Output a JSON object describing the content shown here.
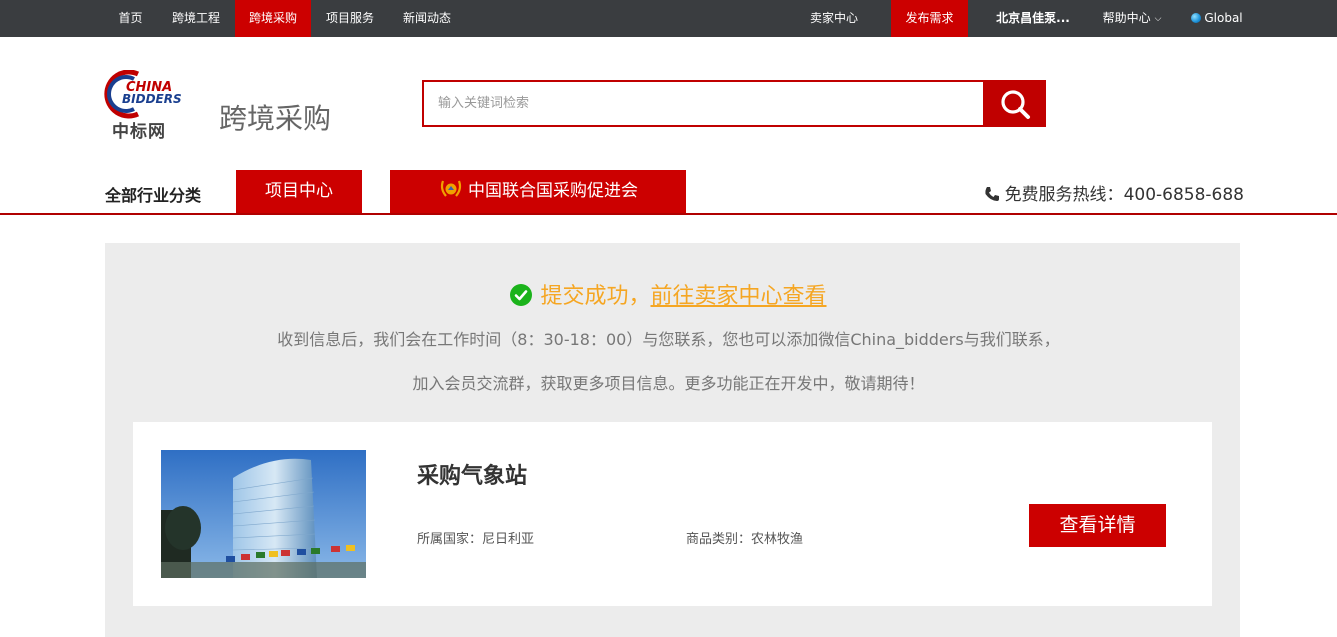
{
  "topbar": {
    "left": [
      "首页",
      "跨境工程",
      "跨境采购",
      "项目服务",
      "新闻动态"
    ],
    "active_index": 2,
    "seller_center": "卖家中心",
    "publish": "发布需求",
    "company": "北京昌佳泵...",
    "help": "帮助中心",
    "global": "Global"
  },
  "header": {
    "logo_text_cn": "中标网",
    "logo_text_en_1": "CHINA",
    "logo_text_en_2": "BIDDERS",
    "site_title": "跨境采购",
    "search_placeholder": "输入关键词检索"
  },
  "nav": {
    "all_categories": "全部行业分类",
    "tab_project_center": "项目中心",
    "tab_un_procurement": "中国联合国采购促进会",
    "hotline_label": "免费服务热线：",
    "hotline_number": "400-6858-688"
  },
  "content": {
    "success_text": "提交成功，",
    "success_link": "前往卖家中心查看",
    "info_line_1": "收到信息后，我们会在工作时间（8：30-18：00）与您联系，您也可以添加微信China_bidders与我们联系，",
    "info_line_2": "加入会员交流群，获取更多项目信息。更多功能正在开发中，敬请期待！"
  },
  "card": {
    "title": "采购气象站",
    "country_label": "所属国家：",
    "country": "尼日利亚",
    "category_label": "商品类别：",
    "category": "农林牧渔",
    "button": "查看详情"
  },
  "colors": {
    "brand_red": "#cc0000",
    "topbar_bg": "#3a3d40",
    "success_orange": "#f5a623",
    "success_green": "#1bb31b",
    "panel_gray": "#ececec"
  },
  "icons": [
    "globe-icon",
    "chevron-down-icon",
    "search-icon",
    "phone-icon",
    "check-circle-icon",
    "un-emblem-icon"
  ]
}
